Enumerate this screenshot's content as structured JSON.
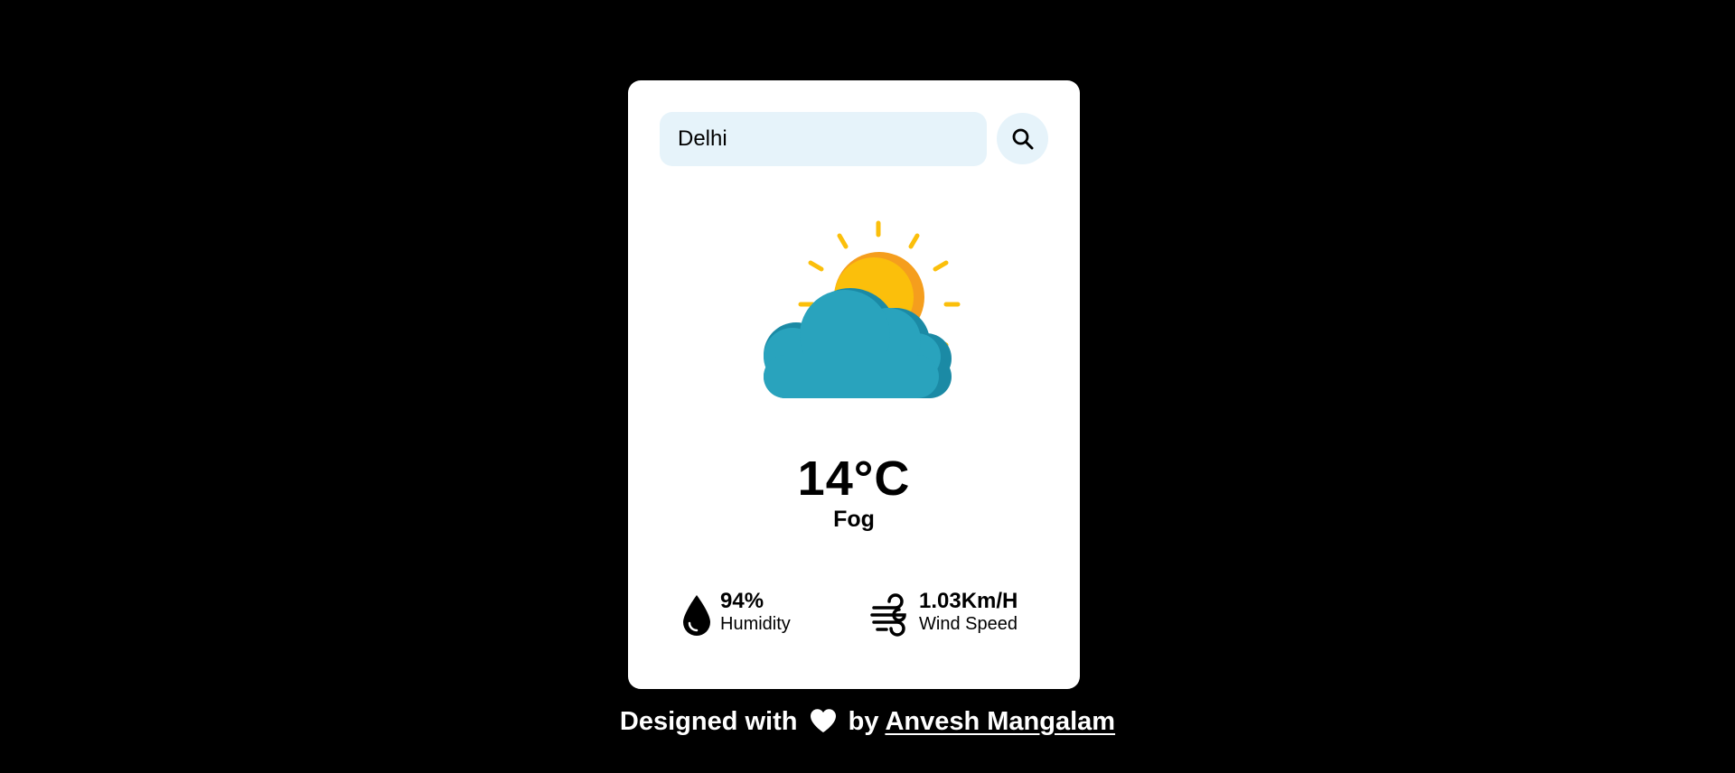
{
  "search": {
    "value": "Delhi",
    "icon": "search-icon"
  },
  "weather": {
    "icon": "sun-behind-cloud-icon",
    "temperature": "14°C",
    "condition": "Fog",
    "humidity": {
      "value": "94%",
      "label": "Humidity",
      "icon": "water-drop-icon"
    },
    "wind": {
      "value": "1.03Km/H",
      "label": "Wind Speed",
      "icon": "wind-icon"
    }
  },
  "footer": {
    "prefix": "Designed with",
    "connector": "by",
    "author": "Anvesh Mangalam",
    "icon": "heart-icon"
  },
  "colors": {
    "page_background": "#000000",
    "card_background": "#ffffff",
    "input_background": "#e6f3fa",
    "sun": "#fbbf0b",
    "sun_shadow": "#f59e1d",
    "cloud": "#29a3bd",
    "cloud_shadow": "#1b8aa5"
  }
}
